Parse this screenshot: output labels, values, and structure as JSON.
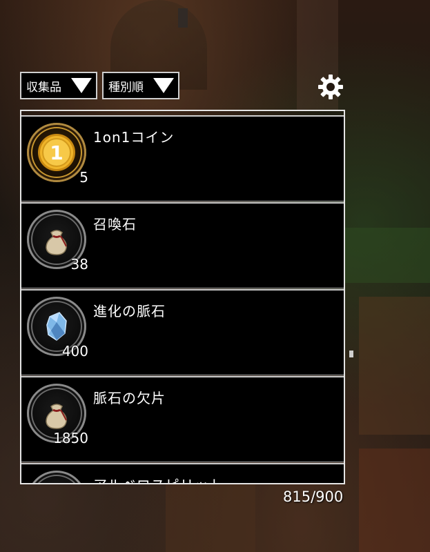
{
  "filters": {
    "category_label": "収集品",
    "sort_label": "種別順"
  },
  "items": [
    {
      "name": "1on1コイン",
      "count": "5",
      "icon": "gold-coin-icon"
    },
    {
      "name": "召喚石",
      "count": "38",
      "icon": "cloth-bag-icon"
    },
    {
      "name": "進化の脈石",
      "count": "400",
      "icon": "blue-crystal-icon"
    },
    {
      "name": "脈石の欠片",
      "count": "1850",
      "icon": "cloth-bag-icon"
    },
    {
      "name": "アルベロスピリット",
      "count": "",
      "icon": "cloth-bag-icon"
    }
  ],
  "capacity": "815/900",
  "colors": {
    "panel_bg": "#000000",
    "border": "#e5e5e5",
    "coin_gold": "#e8a81c"
  }
}
